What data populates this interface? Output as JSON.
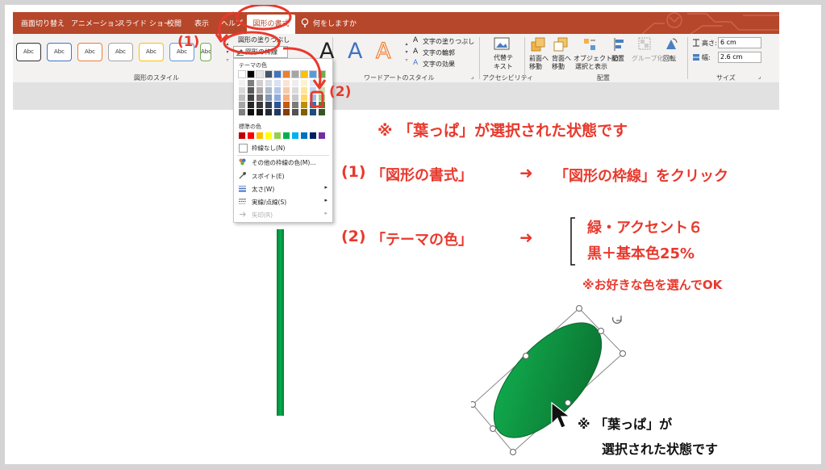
{
  "tabs": [
    {
      "label": "画面切り替え"
    },
    {
      "label": "アニメーション"
    },
    {
      "label": "スライド ショー"
    },
    {
      "label": "校閲"
    },
    {
      "label": "表示"
    },
    {
      "label": "ヘルプ"
    },
    {
      "label": "図形の書式"
    }
  ],
  "tell_me": "何をしますか",
  "shape_styles": {
    "group_label": "図形のスタイル",
    "thumb_label": "Abc",
    "fill_label": "図形の塗りつぶし",
    "outline_label": "図形の枠線",
    "outline_colors": [
      "#333333",
      "#4472c4",
      "#ed7d31",
      "#a5a5a5",
      "#ffc000",
      "#5b9bd5",
      "#70ad47"
    ]
  },
  "wordart": {
    "group_label": "ワードアートのスタイル",
    "text_fill": "文字の塗りつぶし",
    "text_outline": "文字の輪郭",
    "text_effects": "文字の効果",
    "glyph": "A"
  },
  "accessibility": {
    "alt_text_line1": "代替テ",
    "alt_text_line2": "キスト",
    "group_label": "アクセシビリティ"
  },
  "arrange": {
    "group_label": "配置",
    "bring_forward_1": "前面へ",
    "bring_forward_2": "移動",
    "send_backward_1": "背面へ",
    "send_backward_2": "移動",
    "selection_pane_1": "オブジェクトの",
    "selection_pane_2": "選択と表示",
    "align": "配置",
    "group": "グループ化",
    "rotate": "回転"
  },
  "size": {
    "group_label": "サイズ",
    "height_label": "高さ:",
    "height_value": "6 cm",
    "width_label": "幅:",
    "width_value": "2.6 cm"
  },
  "dropdown": {
    "theme_label": "テーマの色",
    "standard_label": "標準の色",
    "no_outline": "枠線なし(N)",
    "more_colors": "その他の枠線の色(M)...",
    "eyedropper": "スポイト(E)",
    "weight": "太さ(W)",
    "dashes": "実線/点線(S)",
    "arrows": "矢印(R)",
    "theme_top": [
      "#ffffff",
      "#000000",
      "#e7e6e6",
      "#44546a",
      "#4472c4",
      "#ed7d31",
      "#a5a5a5",
      "#ffc000",
      "#5b9bd5",
      "#70ad47"
    ],
    "theme_shades": [
      [
        "#f2f2f2",
        "#d9d9d9",
        "#bfbfbf",
        "#a6a6a6",
        "#808080"
      ],
      [
        "#7f7f7f",
        "#595959",
        "#404040",
        "#262626",
        "#0d0d0d"
      ],
      [
        "#d0cece",
        "#aeaaaa",
        "#757171",
        "#3a3838",
        "#171616"
      ],
      [
        "#d6dce4",
        "#adb9ca",
        "#8496b0",
        "#333f50",
        "#222a35"
      ],
      [
        "#d9e2f3",
        "#b4c6e7",
        "#8eaadb",
        "#2f5496",
        "#1f3864"
      ],
      [
        "#fbe4d5",
        "#f7caac",
        "#f4b083",
        "#c55a11",
        "#833c0b"
      ],
      [
        "#ededed",
        "#dbdbdb",
        "#c9c9c9",
        "#7b7b7b",
        "#525252"
      ],
      [
        "#fff2cc",
        "#fee599",
        "#ffd965",
        "#bf8f00",
        "#7f6000"
      ],
      [
        "#deebf6",
        "#bdd7ee",
        "#9cc3e5",
        "#2e75b5",
        "#1e4e79"
      ],
      [
        "#e2efd9",
        "#c5e0b3",
        "#a8d08d",
        "#538135",
        "#375623"
      ]
    ],
    "standard_colors": [
      "#c00000",
      "#ff0000",
      "#ffc000",
      "#ffff00",
      "#92d050",
      "#00b050",
      "#00b0f0",
      "#0070c0",
      "#002060",
      "#7030a0"
    ]
  },
  "annotations": {
    "step1_marker": "(1)",
    "step2_marker": "(2)",
    "headline": "※ 「葉っぱ」が選択された状態です",
    "step1_num": "(1)",
    "step1_text": "「図形の書式」",
    "arrow": "➜",
    "step1_result": "「図形の枠線」をクリック",
    "step2_num": "(2)",
    "step2_text": "「テーマの色」",
    "color_line1": "緑・アクセント６",
    "color_line2": "黒＋基本色25%",
    "note": "※お好きな色を選んでOK",
    "leaf_note_1": "※ 「葉っぱ」が",
    "leaf_note_2": "選択された状態です"
  },
  "colors": {
    "ribbon": "#b7472a",
    "annotation_red": "#e8392d",
    "leaf_green": "#00b050",
    "leaf_dark": "#0a7a35"
  }
}
